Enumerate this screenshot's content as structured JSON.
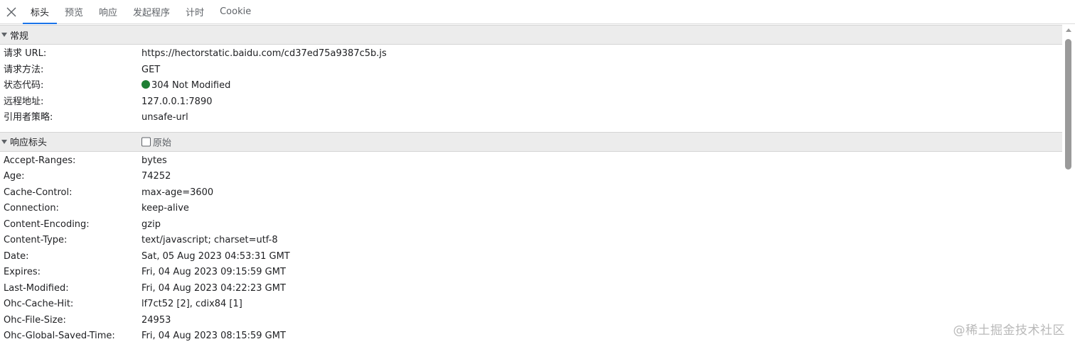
{
  "tabs": [
    {
      "label": "标头",
      "active": true
    },
    {
      "label": "预览",
      "active": false
    },
    {
      "label": "响应",
      "active": false
    },
    {
      "label": "发起程序",
      "active": false
    },
    {
      "label": "计时",
      "active": false
    },
    {
      "label": "Cookie",
      "active": false
    }
  ],
  "general": {
    "title": "常规",
    "rows": [
      {
        "key": "请求 URL:",
        "value": "https://hectorstatic.baidu.com/cd37ed75a9387c5b.js"
      },
      {
        "key": "请求方法:",
        "value": "GET"
      },
      {
        "key": "状态代码:",
        "value": "304 Not Modified"
      },
      {
        "key": "远程地址:",
        "value": "127.0.0.1:7890"
      },
      {
        "key": "引用者策略:",
        "value": "unsafe-url"
      }
    ]
  },
  "response_headers": {
    "title": "响应标头",
    "raw_label": "原始",
    "raw_checked": false,
    "rows": [
      {
        "key": "Accept-Ranges:",
        "value": "bytes"
      },
      {
        "key": "Age:",
        "value": "74252"
      },
      {
        "key": "Cache-Control:",
        "value": "max-age=3600"
      },
      {
        "key": "Connection:",
        "value": "keep-alive"
      },
      {
        "key": "Content-Encoding:",
        "value": "gzip"
      },
      {
        "key": "Content-Type:",
        "value": "text/javascript; charset=utf-8"
      },
      {
        "key": "Date:",
        "value": "Sat, 05 Aug 2023 04:53:31 GMT"
      },
      {
        "key": "Expires:",
        "value": "Fri, 04 Aug 2023 09:15:59 GMT"
      },
      {
        "key": "Last-Modified:",
        "value": "Fri, 04 Aug 2023 04:22:23 GMT"
      },
      {
        "key": "Ohc-Cache-Hit:",
        "value": "lf7ct52 [2], cdix84 [1]"
      },
      {
        "key": "Ohc-File-Size:",
        "value": "24953"
      },
      {
        "key": "Ohc-Global-Saved-Time:",
        "value": "Fri, 04 Aug 2023 08:15:59 GMT"
      }
    ]
  },
  "status_color": "#1e7f34",
  "accent_color": "#1a73e8",
  "watermark": "@稀土掘金技术社区"
}
